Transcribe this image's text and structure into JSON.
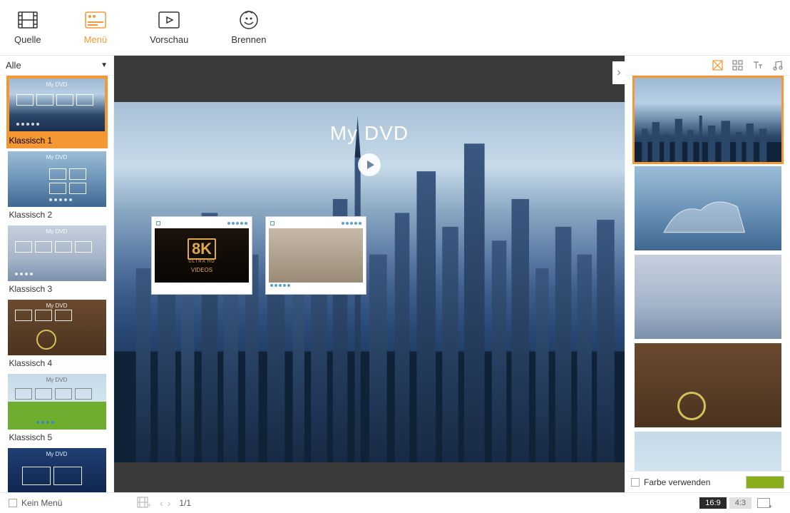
{
  "nav": {
    "quelle": "Quelle",
    "menu": "Menü",
    "vorschau": "Vorschau",
    "brennen": "Brennen"
  },
  "filter": {
    "label": "Alle"
  },
  "templates": [
    {
      "label": "Klassisch 1",
      "title": "My DVD",
      "selected": true
    },
    {
      "label": "Klassisch 2",
      "title": "My DVD"
    },
    {
      "label": "Klassisch 3",
      "title": "My DVD"
    },
    {
      "label": "Klassisch 4",
      "title": "My DVD"
    },
    {
      "label": "Klassisch 5",
      "title": "My DVD"
    },
    {
      "label": "",
      "title": "My DVD"
    }
  ],
  "preview": {
    "title": "My DVD",
    "chapter1_badge": "8K",
    "chapter1_sub": "ULTRA HD",
    "chapter1_sub2": "VIDEOS"
  },
  "paging": {
    "text": "1/1"
  },
  "aspect": {
    "r169": "16:9",
    "r43": "4:3"
  },
  "bottom": {
    "kein_menu": "Kein Menü"
  },
  "right": {
    "farbe": "Farbe verwenden"
  }
}
